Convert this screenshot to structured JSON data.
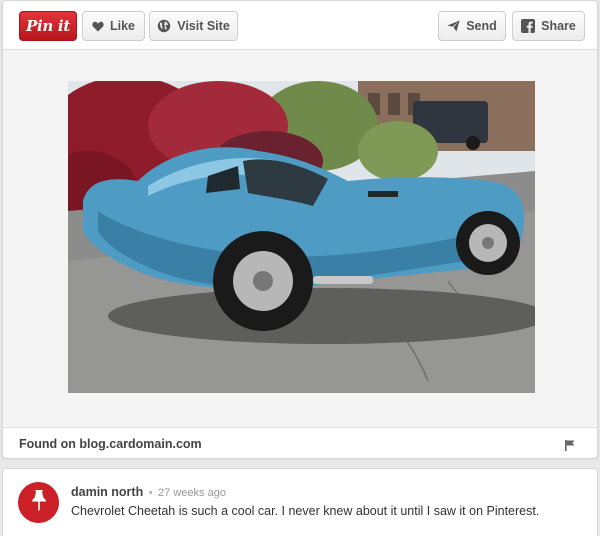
{
  "toolbar": {
    "pin_label": "Pin it",
    "like_label": "Like",
    "visit_label": "Visit Site",
    "send_label": "Send",
    "share_label": "Share"
  },
  "source": {
    "found_prefix": "Found on",
    "domain": "blog.cardomain.com"
  },
  "comment": {
    "author": "damin north",
    "separator": "•",
    "time": "27 weeks ago",
    "text": "Chevrolet Cheetah is such a cool car. I never knew about it until I saw it on Pinterest."
  },
  "colors": {
    "pin_red": "#cb2027",
    "car_blue": "#4e9cc4",
    "background": "#e9e9e9"
  },
  "icons": {
    "like": "heart-icon",
    "visit": "globe-icon",
    "send": "paper-plane-icon",
    "share": "facebook-icon",
    "flag": "flag-icon",
    "avatar": "pushpin-icon"
  }
}
